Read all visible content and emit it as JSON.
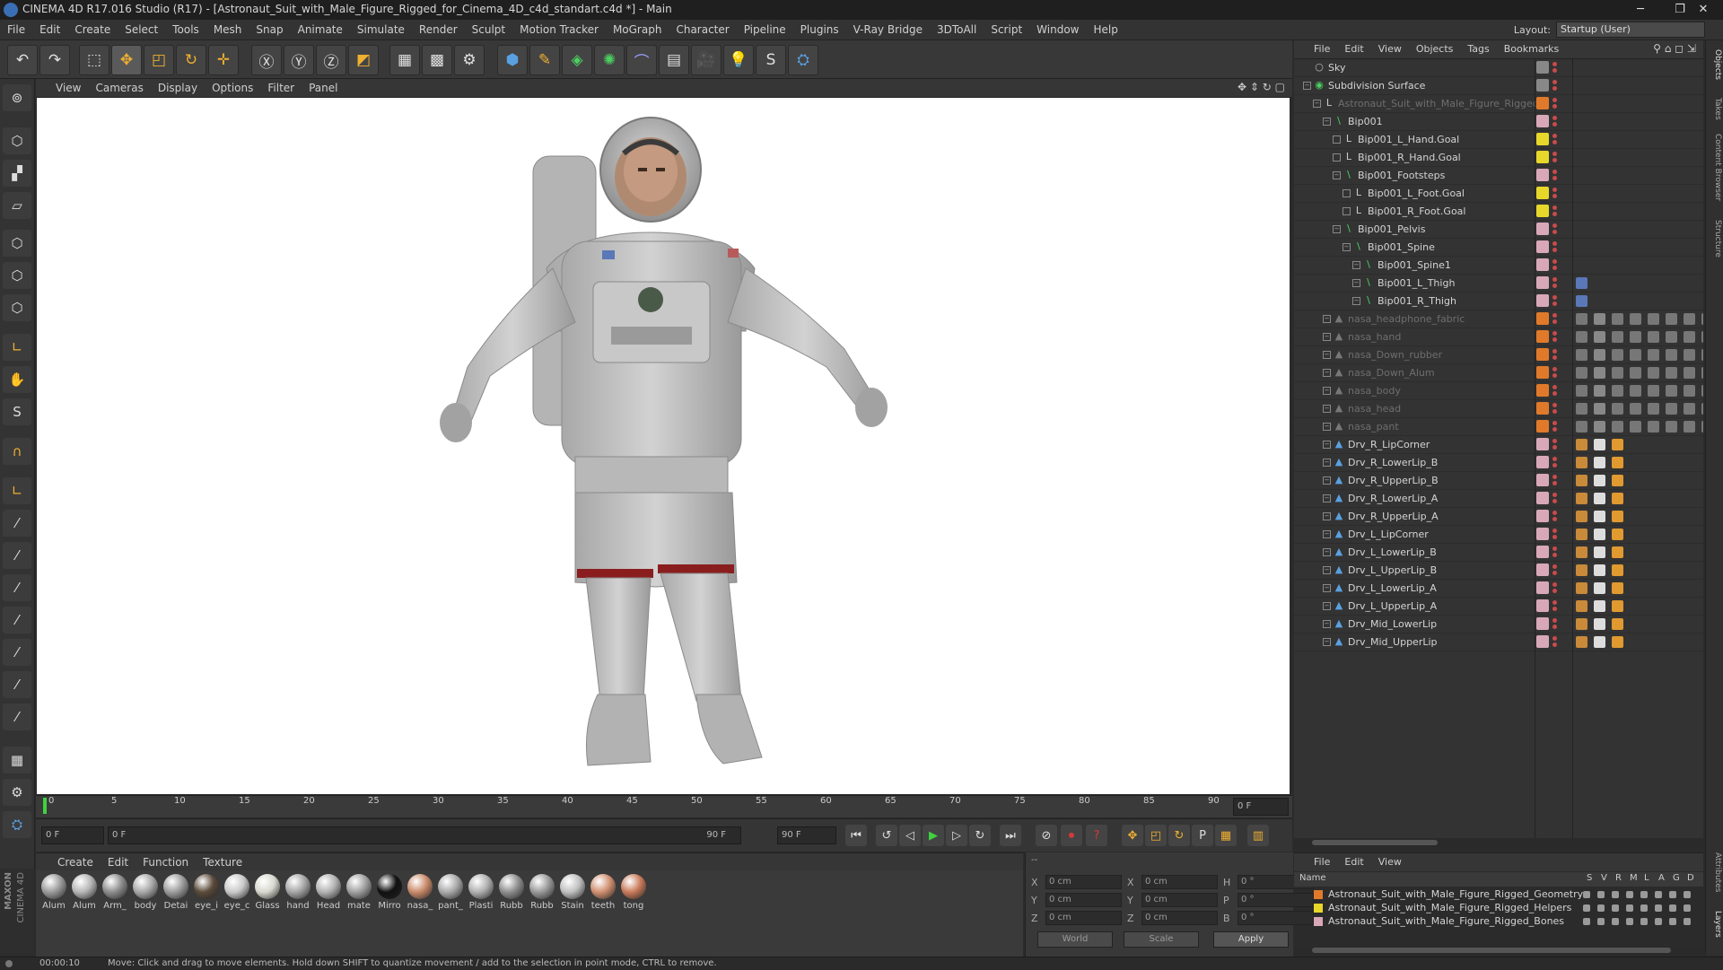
{
  "window": {
    "title": "CINEMA 4D R17.016 Studio (R17) - [Astronaut_Suit_with_Male_Figure_Rigged_for_Cinema_4D_c4d_standart.c4d *] - Main",
    "min_glyph": "─",
    "max_glyph": "❐",
    "close_glyph": "✕"
  },
  "menu": [
    "File",
    "Edit",
    "Create",
    "Select",
    "Tools",
    "Mesh",
    "Snap",
    "Animate",
    "Simulate",
    "Render",
    "Sculpt",
    "Motion Tracker",
    "MoGraph",
    "Character",
    "Pipeline",
    "Plugins",
    "V-Ray Bridge",
    "3DToAll",
    "Script",
    "Window",
    "Help"
  ],
  "layout": {
    "label": "Layout:",
    "value": "Startup (User)"
  },
  "viewport_menu": [
    "View",
    "Cameras",
    "Display",
    "Options",
    "Filter",
    "Panel"
  ],
  "timeline": {
    "ticks": [
      "0",
      "5",
      "10",
      "15",
      "20",
      "25",
      "30",
      "35",
      "40",
      "45",
      "50",
      "55",
      "60",
      "65",
      "70",
      "75",
      "80",
      "85",
      "90"
    ],
    "current_frame": "0 F",
    "start_field": "0 F",
    "start_field2": "0 F",
    "end_field": "90 F",
    "end_field2": "90 F"
  },
  "material_menu": [
    "Create",
    "Edit",
    "Function",
    "Texture"
  ],
  "materials": [
    {
      "name": "Alum",
      "color": "#9a9a9a"
    },
    {
      "name": "Alum",
      "color": "#b5b5b5"
    },
    {
      "name": "Arm_",
      "color": "#8c8c8c"
    },
    {
      "name": "body",
      "color": "#a8a8a8"
    },
    {
      "name": "Detai",
      "color": "#9c9c9c"
    },
    {
      "name": "eye_i",
      "color": "#5a4a3a"
    },
    {
      "name": "eye_c",
      "color": "#c9c9c9"
    },
    {
      "name": "Glass",
      "color": "#d8d8d0"
    },
    {
      "name": "hand",
      "color": "#a5a5a5"
    },
    {
      "name": "Head",
      "color": "#b2b2b2"
    },
    {
      "name": "mate",
      "color": "#a0a0a0"
    },
    {
      "name": "Mirro",
      "color": "#111111"
    },
    {
      "name": "nasa_",
      "color": "#c98a6a"
    },
    {
      "name": "pant_",
      "color": "#a9a9a9"
    },
    {
      "name": "Plasti",
      "color": "#b0b0b0"
    },
    {
      "name": "Rubb",
      "color": "#8e8e8e"
    },
    {
      "name": "Rubb",
      "color": "#999999"
    },
    {
      "name": "Stain",
      "color": "#c0c0c0"
    },
    {
      "name": "teeth",
      "color": "#d09070"
    },
    {
      "name": "tong",
      "color": "#c97a5a"
    }
  ],
  "coords": {
    "x_label": "X",
    "y_label": "Y",
    "z_label": "Z",
    "h_label": "H",
    "p_label": "P",
    "b_label": "B",
    "x_pos": "0 cm",
    "y_pos": "0 cm",
    "z_pos": "0 cm",
    "x_size": "0 cm",
    "y_size": "0 cm",
    "z_size": "0 cm",
    "h": "0 °",
    "p": "0 °",
    "b": "0 °",
    "space": "World",
    "mode": "Scale",
    "apply": "Apply",
    "header": "--"
  },
  "status": {
    "time": "00:00:10",
    "message": "Move: Click and drag to move elements. Hold down SHIFT to quantize movement / add to the selection in point mode, CTRL to remove."
  },
  "object_menu": [
    "File",
    "Edit",
    "View",
    "Objects",
    "Tags",
    "Bookmarks"
  ],
  "objects": [
    {
      "name": "Sky",
      "icon": "○",
      "level": 0,
      "color": "#888888",
      "dim": false,
      "exp": false,
      "type": "sky"
    },
    {
      "name": "Subdivision Surface",
      "icon": "◉",
      "level": 0,
      "color": "#888888",
      "dim": false,
      "exp": true,
      "type": "subd"
    },
    {
      "name": "Astronaut_Suit_with_Male_Figure_Rigged",
      "icon": "L",
      "level": 1,
      "color": "#e07a2a",
      "dim": true,
      "exp": true,
      "type": "null"
    },
    {
      "name": "Bip001",
      "icon": "\\",
      "level": 2,
      "color": "#d8a8b8",
      "dim": false,
      "exp": true,
      "type": "bone"
    },
    {
      "name": "Bip001_L_Hand.Goal",
      "icon": "L",
      "level": 3,
      "color": "#e6d72a",
      "dim": false,
      "exp": false,
      "type": "null"
    },
    {
      "name": "Bip001_R_Hand.Goal",
      "icon": "L",
      "level": 3,
      "color": "#e6d72a",
      "dim": false,
      "exp": false,
      "type": "null"
    },
    {
      "name": "Bip001_Footsteps",
      "icon": "\\",
      "level": 3,
      "color": "#d8a8b8",
      "dim": false,
      "exp": true,
      "type": "bone"
    },
    {
      "name": "Bip001_L_Foot.Goal",
      "icon": "L",
      "level": 4,
      "color": "#e6d72a",
      "dim": false,
      "exp": false,
      "type": "null"
    },
    {
      "name": "Bip001_R_Foot.Goal",
      "icon": "L",
      "level": 4,
      "color": "#e6d72a",
      "dim": false,
      "exp": false,
      "type": "null"
    },
    {
      "name": "Bip001_Pelvis",
      "icon": "\\",
      "level": 3,
      "color": "#d8a8b8",
      "dim": false,
      "exp": true,
      "type": "bone"
    },
    {
      "name": "Bip001_Spine",
      "icon": "\\",
      "level": 4,
      "color": "#d8a8b8",
      "dim": false,
      "exp": true,
      "type": "bone"
    },
    {
      "name": "Bip001_Spine1",
      "icon": "\\",
      "level": 5,
      "color": "#d8a8b8",
      "dim": false,
      "exp": true,
      "type": "bone"
    },
    {
      "name": "Bip001_L_Thigh",
      "icon": "\\",
      "level": 5,
      "color": "#d8a8b8",
      "dim": false,
      "exp": true,
      "type": "bone"
    },
    {
      "name": "Bip001_R_Thigh",
      "icon": "\\",
      "level": 5,
      "color": "#d8a8b8",
      "dim": false,
      "exp": true,
      "type": "bone"
    },
    {
      "name": "nasa_headphone_fabric",
      "icon": "▲",
      "level": 2,
      "color": "#e07a2a",
      "dim": true,
      "exp": true,
      "type": "mesh"
    },
    {
      "name": "nasa_hand",
      "icon": "▲",
      "level": 2,
      "color": "#e07a2a",
      "dim": true,
      "exp": true,
      "type": "mesh"
    },
    {
      "name": "nasa_Down_rubber",
      "icon": "▲",
      "level": 2,
      "color": "#e07a2a",
      "dim": true,
      "exp": true,
      "type": "mesh"
    },
    {
      "name": "nasa_Down_Alum",
      "icon": "▲",
      "level": 2,
      "color": "#e07a2a",
      "dim": true,
      "exp": true,
      "type": "mesh"
    },
    {
      "name": "nasa_body",
      "icon": "▲",
      "level": 2,
      "color": "#e07a2a",
      "dim": true,
      "exp": true,
      "type": "mesh"
    },
    {
      "name": "nasa_head",
      "icon": "▲",
      "level": 2,
      "color": "#e07a2a",
      "dim": true,
      "exp": true,
      "type": "mesh"
    },
    {
      "name": "nasa_pant",
      "icon": "▲",
      "level": 2,
      "color": "#e07a2a",
      "dim": true,
      "exp": true,
      "type": "mesh"
    },
    {
      "name": "Drv_R_LipCorner",
      "icon": "▲",
      "level": 2,
      "color": "#d8a8b8",
      "dim": false,
      "exp": true,
      "type": "driver"
    },
    {
      "name": "Drv_R_LowerLip_B",
      "icon": "▲",
      "level": 2,
      "color": "#d8a8b8",
      "dim": false,
      "exp": true,
      "type": "driver"
    },
    {
      "name": "Drv_R_UpperLip_B",
      "icon": "▲",
      "level": 2,
      "color": "#d8a8b8",
      "dim": false,
      "exp": true,
      "type": "driver"
    },
    {
      "name": "Drv_R_LowerLip_A",
      "icon": "▲",
      "level": 2,
      "color": "#d8a8b8",
      "dim": false,
      "exp": true,
      "type": "driver"
    },
    {
      "name": "Drv_R_UpperLip_A",
      "icon": "▲",
      "level": 2,
      "color": "#d8a8b8",
      "dim": false,
      "exp": true,
      "type": "driver"
    },
    {
      "name": "Drv_L_LipCorner",
      "icon": "▲",
      "level": 2,
      "color": "#d8a8b8",
      "dim": false,
      "exp": true,
      "type": "driver"
    },
    {
      "name": "Drv_L_LowerLip_B",
      "icon": "▲",
      "level": 2,
      "color": "#d8a8b8",
      "dim": false,
      "exp": true,
      "type": "driver"
    },
    {
      "name": "Drv_L_UpperLip_B",
      "icon": "▲",
      "level": 2,
      "color": "#d8a8b8",
      "dim": false,
      "exp": true,
      "type": "driver"
    },
    {
      "name": "Drv_L_LowerLip_A",
      "icon": "▲",
      "level": 2,
      "color": "#d8a8b8",
      "dim": false,
      "exp": true,
      "type": "driver"
    },
    {
      "name": "Drv_L_UpperLip_A",
      "icon": "▲",
      "level": 2,
      "color": "#d8a8b8",
      "dim": false,
      "exp": true,
      "type": "driver"
    },
    {
      "name": "Drv_Mid_LowerLip",
      "icon": "▲",
      "level": 2,
      "color": "#d8a8b8",
      "dim": false,
      "exp": true,
      "type": "driver"
    },
    {
      "name": "Drv_Mid_UpperLip",
      "icon": "▲",
      "level": 2,
      "color": "#d8a8b8",
      "dim": false,
      "exp": true,
      "type": "driver"
    }
  ],
  "layer_menu": [
    "File",
    "Edit",
    "View"
  ],
  "layer_columns": {
    "name": "Name",
    "s": "S",
    "v": "V",
    "r": "R",
    "m": "M",
    "l": "L",
    "a": "A",
    "g": "G",
    "d": "D"
  },
  "layers": [
    {
      "name": "Astronaut_Suit_with_Male_Figure_Rigged_Geometry",
      "color": "#e07a2a"
    },
    {
      "name": "Astronaut_Suit_with_Male_Figure_Rigged_Helpers",
      "color": "#e6d72a"
    },
    {
      "name": "Astronaut_Suit_with_Male_Figure_Rigged_Bones",
      "color": "#d8a8b8"
    }
  ],
  "right_tabs": [
    "Objects",
    "Takes",
    "Content Browser",
    "Structure"
  ],
  "right_tabs_lower": [
    "Attributes",
    "Layers"
  ],
  "brand": {
    "line1": "MAXON",
    "line2": "CINEMA 4D"
  },
  "colors": {
    "accent": "#3b6fb5",
    "play": "#3fd23f",
    "record": "#d23a3a"
  }
}
